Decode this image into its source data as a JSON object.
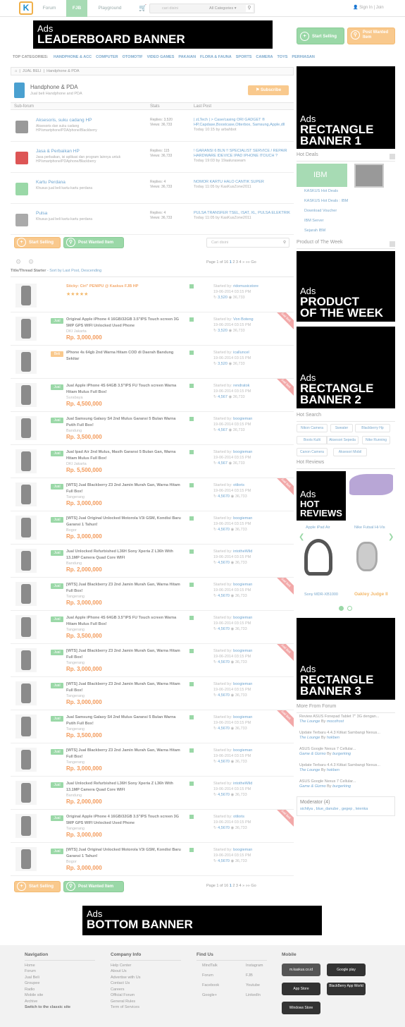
{
  "nav": {
    "forum": "Forum",
    "fjb": "FJB",
    "playground": "Playground",
    "search_placeholder": "cari disini",
    "all_categories": "All Categories",
    "signin": "Sign In | Join"
  },
  "ads": {
    "leaderboard": [
      "Ads",
      "LEADERBOARD BANNER"
    ],
    "rect1": [
      "Ads",
      "RECTANGLE",
      "BANNER 1"
    ],
    "potw": [
      "Ads",
      "PRODUCT",
      "OF THE WEEK"
    ],
    "rect2": [
      "Ads",
      "RECTANGLE",
      "BANNER 2"
    ],
    "hotreviews": [
      "Ads",
      "HOT",
      "REVIEWS"
    ],
    "rect3": [
      "Ads",
      "RECTANGLE",
      "BANNER 3"
    ],
    "bottom": [
      "Ads",
      "BOTTOM BANNER"
    ]
  },
  "actions": {
    "start_selling": "Start Selling",
    "post_wanted": "Post Wanted Item",
    "subscribe": "Subscribe"
  },
  "top_categories": {
    "label": "TOP CATEGORIES:",
    "items": [
      "HANDPHONE & ACC",
      "COMPUTER",
      "OTOMOTIF",
      "VIDEO GAMES",
      "PAKAIAN",
      "FLORA & FAUNA",
      "SPORTS",
      "CAMERA",
      "TOYS",
      "PERHIASAN"
    ]
  },
  "breadcrumb": [
    "JUAL BELI",
    "Handphone & PDA"
  ],
  "forum": {
    "title": "Handphone & PDA",
    "desc": "Jual beli Handphone and PDA"
  },
  "subforum_head": {
    "col1": "Sub-forum",
    "col2": "Stats",
    "col3": "Last Post"
  },
  "subforums": [
    {
      "name": "Aksesoris, suku cadang HP",
      "desc": "Aksesoris dan suku cadang HP/smartphone/PDA/phone/Blackberry",
      "replies": "Replies: 3,520",
      "views": "Views: 36,733",
      "lp": "| zLTech | > Case/casing ORI GADGET ® HP,Capdase,Boostcase,Otterbox, Samsung,Apple,dll",
      "lp_time": "Today 10:15 by arbahbot"
    },
    {
      "name": "Jasa & Perbaikan HP",
      "desc": "Jasa perbaikan, isi aplikasi dan program lainnya untuk HP/smartphone/PDAphone/Blackberry",
      "replies": "Replies: 115",
      "views": "Views: 36,733",
      "lp": "! GARANSI 6 BLN !! SPECIALIST SERVICE / REPAIR HARDWARE IDEVICE IPAD IPHONE ITOUCH ?",
      "lp_time": "Today 19:03 by 19aaluraseam"
    },
    {
      "name": "Kartu Perdana",
      "desc": "Khusus jual beli kartu-kartu perdana",
      "replies": "Replies: 4",
      "views": "Views: 36,733",
      "lp": "NOMOR KARTU HALO CANTIK SUPER",
      "lp_time": "Today 11:05 by KasKusZone2011"
    },
    {
      "name": "Pulsa",
      "desc": "Khusus jual beli kartu-kartu perdana",
      "replies": "Replies: 4",
      "views": "Views: 36,733",
      "lp": "PULSA TRANSFER TSEL, ISAT, XL, PULSA ELEKTRIK",
      "lp_time": "Today 11:05 by KasKusZone2011"
    }
  ],
  "search_box": "Cari disini",
  "pager": {
    "text": "Page 1 of 16",
    "current": "1",
    "pages": [
      "2",
      "3",
      "4",
      "»",
      "»»",
      "Go"
    ]
  },
  "sortbar": {
    "label": "Title/Thread Starter",
    "sort": "- Sort by Last Post, Descending"
  },
  "threads": [
    {
      "badge": "",
      "title": "Sticky: Ciri\" PENIPU @ Kaskus FJB HP",
      "loc": "",
      "price": "",
      "sticky": true,
      "ribbon": false,
      "starter": "ridomusicstore",
      "date": "19-06-2014 03:15 PM",
      "replies": "3,520",
      "views": "36,733"
    },
    {
      "badge": "Jual",
      "title": "Original Apple iPhone 4 16GB/32GB 3.5\"IPS Touch screen 3G 5MP GPS WIFI Unlocked Used Phone",
      "loc": "DKI Jakarta",
      "price": "Rp. 3,000,000",
      "sticky": false,
      "ribbon": true,
      "starter": "Von Boteng",
      "date": "19-06-2014 03:15 PM",
      "replies": "3,520",
      "views": "36,733"
    },
    {
      "badge": "Beli",
      "title": "iPhone 4s 64gb 2nd Warna Hitam COD di Daerah Bandung Sekitar",
      "loc": "",
      "price": "",
      "sticky": false,
      "ribbon": false,
      "starter": "icalluncel",
      "date": "19-06-2014 03:15 PM",
      "replies": "3,520",
      "views": "36,733"
    },
    {
      "badge": "Jual",
      "title": "Jual Apple iPhone 4S 64GB 3.5\"IPS FU Touch screen Warna Hitam Mulus Full Box!",
      "loc": "Surabaya",
      "price": "Rp. 4,500,000",
      "sticky": false,
      "ribbon": true,
      "starter": "rendratok",
      "date": "19-06-2014 03:15 PM",
      "replies": "4,567",
      "views": "36,733"
    },
    {
      "badge": "Jual",
      "title": "Jual Samsung Galaxy S4 2nd Mulus Garansi 5 Bulan Warna Putih Full Box!",
      "loc": "Bandung",
      "price": "Rp. 3,500,000",
      "sticky": false,
      "ribbon": false,
      "starter": "boogieman",
      "date": "19-06-2014 03:15 PM",
      "replies": "4,567",
      "views": "36,733"
    },
    {
      "badge": "Jual",
      "title": "Jual Ipad Air 2nd Mulus, Masih Garansi 5 Bulan Gan, Warna Hitam Mulus Full Box!",
      "loc": "DKI Jakarta",
      "price": "Rp. 5,500,000",
      "sticky": false,
      "ribbon": false,
      "starter": "boogieman",
      "date": "19-06-2014 03:15 PM",
      "replies": "4,567",
      "views": "36,733"
    },
    {
      "badge": "Jual",
      "title": "[WTS] Jual Blackberry Z3 2nd Jamin Murah Gan, Warna Hitam Full Box!",
      "loc": "Tangerang",
      "price": "Rp. 3,000,000",
      "sticky": false,
      "ribbon": true,
      "starter": "otiloris",
      "date": "19-06-2014 03:15 PM",
      "replies": "4,5670",
      "views": "36,733"
    },
    {
      "badge": "Jual",
      "title": "[WTS] Jual Original Unlocked Motorola V3i GSM, Kondisi Baru Garansi 1 Tahun!",
      "loc": "Bogor",
      "price": "Rp. 3,000,000",
      "sticky": false,
      "ribbon": false,
      "starter": "boogieman",
      "date": "19-06-2014 03:15 PM",
      "replies": "4,5670",
      "views": "36,733"
    },
    {
      "badge": "Jual",
      "title": "Jual Unlocked Refurbished L36H Sony Xperia Z L36h With 13.1MP Camera Quad Core WIFI",
      "loc": "Bandung",
      "price": "Rp. 2,000,000",
      "sticky": false,
      "ribbon": false,
      "starter": "intotheWild",
      "date": "19-06-2014 03:15 PM",
      "replies": "4,5670",
      "views": "36,733"
    },
    {
      "badge": "Jual",
      "title": "[WTS] Jual Blackberry Z3 2nd Jamin Murah Gan, Warna Hitam Full Box!",
      "loc": "Tangerang",
      "price": "Rp. 3,000,000",
      "sticky": false,
      "ribbon": true,
      "starter": "boogieman",
      "date": "19-06-2014 03:15 PM",
      "replies": "4,5670",
      "views": "36,733"
    },
    {
      "badge": "Jual",
      "title": "Jual Apple iPhone 4S 64GB 3.5\"IPS FU Touch screen Warna Hitam Mulus Full Box!",
      "loc": "Tangerang",
      "price": "Rp. 3,500,000",
      "sticky": false,
      "ribbon": false,
      "starter": "boogieman",
      "date": "19-06-2014 03:15 PM",
      "replies": "4,5670",
      "views": "36,733"
    },
    {
      "badge": "Jual",
      "title": "[WTS] Jual Blackberry Z3 2nd Jamin Murah Gan, Warna Hitam Full Box!",
      "loc": "Tangerang",
      "price": "Rp. 3,000,000",
      "sticky": false,
      "ribbon": true,
      "starter": "boogieman",
      "date": "19-06-2014 03:15 PM",
      "replies": "4,5670",
      "views": "36,733"
    },
    {
      "badge": "Jual",
      "title": "[WTS] Jual Blackberry Z3 2nd Jamin Murah Gan, Warna Hitam Full Box!",
      "loc": "Tangerang",
      "price": "Rp. 3,000,000",
      "sticky": false,
      "ribbon": false,
      "starter": "boogieman",
      "date": "19-06-2014 03:15 PM",
      "replies": "4,5670",
      "views": "36,733"
    },
    {
      "badge": "Jual",
      "title": "Jual Samsung Galaxy S4 2nd Mulus Garansi 5 Bulan Warna Putih Full Box!",
      "loc": "Tangerang",
      "price": "Rp. 3,500,000",
      "sticky": false,
      "ribbon": true,
      "starter": "boogieman",
      "date": "19-06-2014 03:15 PM",
      "replies": "4,5670",
      "views": "36,733"
    },
    {
      "badge": "Jual",
      "title": "[WTS] Jual Blackberry Z3 2nd Jamin Murah Gan, Warna Hitam Full Box!",
      "loc": "Tangerang",
      "price": "Rp. 3,000,000",
      "sticky": false,
      "ribbon": false,
      "starter": "boogieman",
      "date": "19-06-2014 03:15 PM",
      "replies": "4,5670",
      "views": "36,733"
    },
    {
      "badge": "Jual",
      "title": "Jual Unlocked Refurbished L36H Sony Xperia Z L36h With 13.1MP Camera Quad Core WIFI",
      "loc": "Bandung",
      "price": "Rp. 2,000,000",
      "sticky": false,
      "ribbon": false,
      "starter": "intotheWild",
      "date": "19-06-2014 03:15 PM",
      "replies": "4,5670",
      "views": "36,733"
    },
    {
      "badge": "Jual",
      "title": "Original Apple iPhone 4 16GB/32GB 3.5\"IPS Touch screen 3G 5MP GPS WIFI Unlocked Used Phone",
      "loc": "Tangerang",
      "price": "Rp. 3,000,000",
      "sticky": false,
      "ribbon": true,
      "starter": "otiloris",
      "date": "19-06-2014 03:15 PM",
      "replies": "4,5670",
      "views": "36,733"
    },
    {
      "badge": "Jual",
      "title": "[WTS] Jual Original Unlocked Motorola V3i GSM, Kondisi Baru Garansi 1 Tahun!",
      "loc": "Bogor",
      "price": "Rp. 3,000,000",
      "sticky": false,
      "ribbon": false,
      "starter": "boogieman",
      "date": "19-06-2014 03:15 PM",
      "replies": "4,5670",
      "views": "36,733"
    }
  ],
  "ribbon_text": "Jual Beli",
  "starter_prefix": "Started by:",
  "sidebar": {
    "hot_deals": "Hot Deals",
    "hot_deals_links": [
      "KASKUS Hot Deals",
      "KASKUS Hot Deals : IBM",
      "Download Voucher",
      "IBM Server",
      "Sejarah IBM"
    ],
    "ibm": "IBM",
    "potw": "Product of The Week",
    "hot_search": "Hot Search",
    "tags": [
      "Nikon Camera",
      "Sweater",
      "Blackberry Hp",
      "Boots Kulit",
      "Aksesori Sepeda",
      "Nike Running",
      "Canon Camera",
      "Aksesori Mobil"
    ],
    "hot_reviews": "Hot Reviews",
    "reviews": [
      "Apple iPad Air",
      "Nike Futsal Hi-Vis",
      "Sony MDR-XB1000",
      "Oakley Judge II"
    ],
    "more_forum": "More From Forum",
    "more": [
      {
        "t": "Review ASUS Fonepad Tablet 7\" 3G dengan...",
        "s": "The Lounge",
        "b": "mocofrost"
      },
      {
        "t": "Update Terbaru 4.4.3 Kitkat Sambangi Nexus...",
        "s": "The Lounge",
        "b": "hokben"
      },
      {
        "t": "ASUS Google Nexus 7 Cellular...",
        "s": "Game & Gizmo",
        "b": "burgerking"
      },
      {
        "t": "Update Terbaru 4.4.3 Kitkat Sambangi Nexus...",
        "s": "The Lounge",
        "b": "hokben"
      },
      {
        "t": "ASUS Google Nexus 7 Cellular...",
        "s": "Game & Gizmo",
        "b": "burgerking"
      }
    ],
    "by": "By",
    "moderator": "Moderator (4)",
    "moderators": "sichilya , blue_danube , gegep , leienka"
  },
  "footer": {
    "nav_title": "Navigation",
    "nav": [
      "Home",
      "Forum",
      "Jual Beli",
      "Groupee",
      "Radio",
      "Mobile site",
      "Archive",
      "Switch to the classic site"
    ],
    "company_title": "Company Info",
    "company": [
      "Help Center",
      "About Us",
      "Advertise with Us",
      "Contact Us",
      "Careers",
      "Official Forum",
      "General Rules",
      "Term of Services"
    ],
    "find_title": "Find Us",
    "find": [
      "MindTalk",
      "Instagram",
      "Forum",
      "FJB",
      "Facebook",
      "Youtube",
      "Google+",
      "LinkedIn"
    ],
    "mobile_title": "Mobile",
    "stores": [
      "m.kaskus.co.id",
      "Google play",
      "App Store",
      "BlackBerry App World",
      "Windows Store"
    ]
  }
}
